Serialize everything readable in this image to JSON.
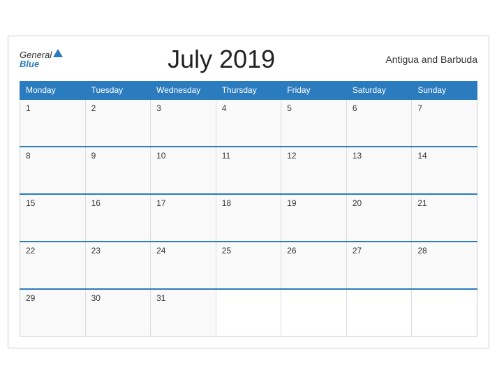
{
  "header": {
    "logo_general": "General",
    "logo_blue": "Blue",
    "title": "July 2019",
    "country": "Antigua and Barbuda"
  },
  "weekdays": [
    "Monday",
    "Tuesday",
    "Wednesday",
    "Thursday",
    "Friday",
    "Saturday",
    "Sunday"
  ],
  "weeks": [
    [
      {
        "day": "1"
      },
      {
        "day": "2"
      },
      {
        "day": "3"
      },
      {
        "day": "4"
      },
      {
        "day": "5"
      },
      {
        "day": "6"
      },
      {
        "day": "7"
      }
    ],
    [
      {
        "day": "8"
      },
      {
        "day": "9"
      },
      {
        "day": "10"
      },
      {
        "day": "11"
      },
      {
        "day": "12"
      },
      {
        "day": "13"
      },
      {
        "day": "14"
      }
    ],
    [
      {
        "day": "15"
      },
      {
        "day": "16"
      },
      {
        "day": "17"
      },
      {
        "day": "18"
      },
      {
        "day": "19"
      },
      {
        "day": "20"
      },
      {
        "day": "21"
      }
    ],
    [
      {
        "day": "22"
      },
      {
        "day": "23"
      },
      {
        "day": "24"
      },
      {
        "day": "25"
      },
      {
        "day": "26"
      },
      {
        "day": "27"
      },
      {
        "day": "28"
      }
    ],
    [
      {
        "day": "29"
      },
      {
        "day": "30"
      },
      {
        "day": "31"
      },
      {
        "day": ""
      },
      {
        "day": ""
      },
      {
        "day": ""
      },
      {
        "day": ""
      }
    ]
  ]
}
